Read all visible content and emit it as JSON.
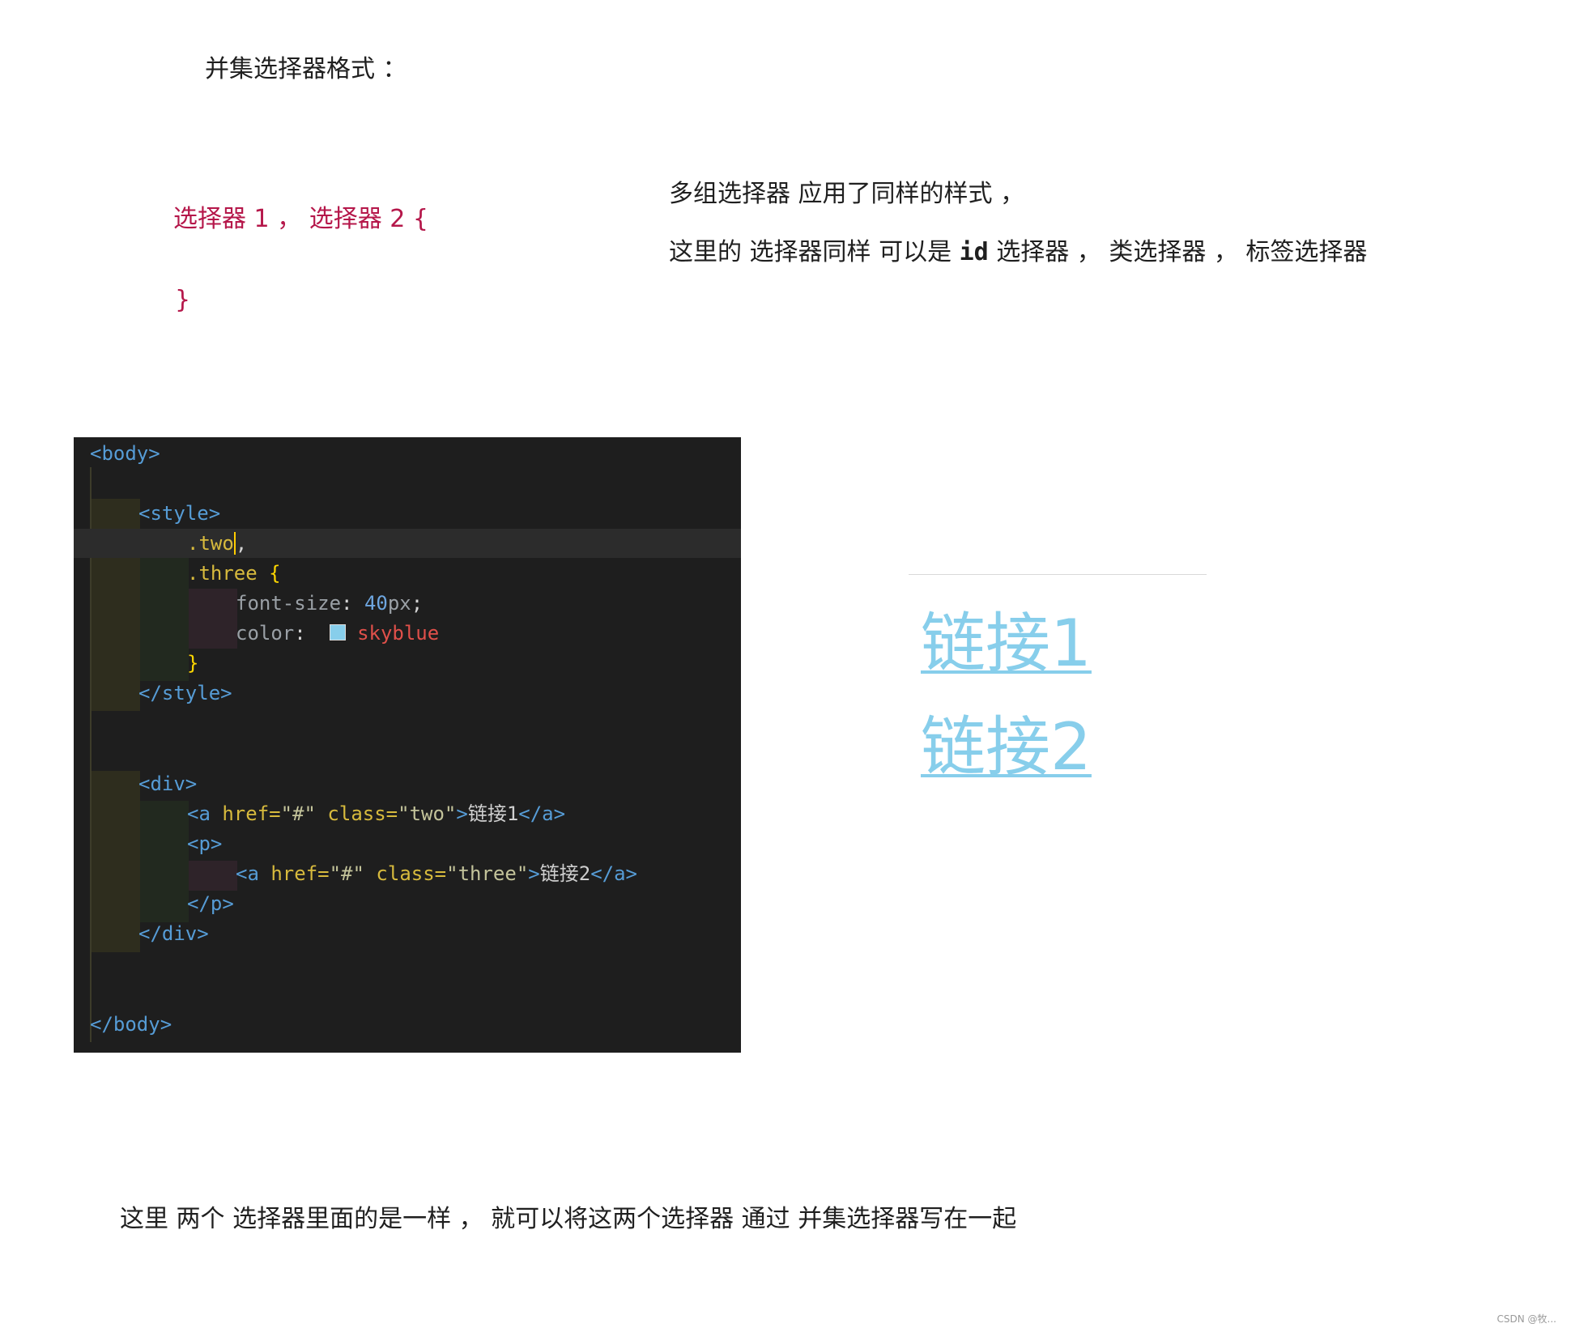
{
  "heading": "并集选择器格式 ：",
  "syntax": {
    "line1": "选择器 1 ， 选择器 2 {",
    "line2": "}"
  },
  "description": {
    "line1": "多组选择器  应用了同样的样式  ，",
    "line2_pre": "这里的  选择器同样  可以是 ",
    "line2_id": "id",
    "line2_post": " 选择器  ，   类选择器  ，   标签选择器"
  },
  "code": {
    "body_open": "<body>",
    "style_open": "<style>",
    "sel_two": ".two",
    "comma": ",",
    "sel_three": ".three",
    "brace_open": " {",
    "prop_font": "font-size",
    "colon": ":",
    "val_num": "40",
    "val_unit": "px",
    "semicolon": ";",
    "prop_color": "color",
    "val_color": "skyblue",
    "brace_close": "}",
    "style_close": "</style>",
    "div_open": "<div>",
    "a_open": "<a",
    "href_attr": " href=",
    "href_val": "\"#\"",
    "class_attr": " class=",
    "class_two": "\"two\"",
    "class_three": "\"three\"",
    "gt": ">",
    "link1_text": "链接1",
    "link2_text": "链接2",
    "a_close": "</a>",
    "p_open": "<p>",
    "p_close": "</p>",
    "div_close": "</div>",
    "body_close": "</body>"
  },
  "preview": {
    "link1": "链接1",
    "link2": "链接2",
    "link_color": "#87ceeb"
  },
  "bottom_note": "这里    两个  选择器里面的是一样  ，   就可以将这两个选择器  通过  并集选择器写在一起",
  "watermark": "CSDN @牧..."
}
